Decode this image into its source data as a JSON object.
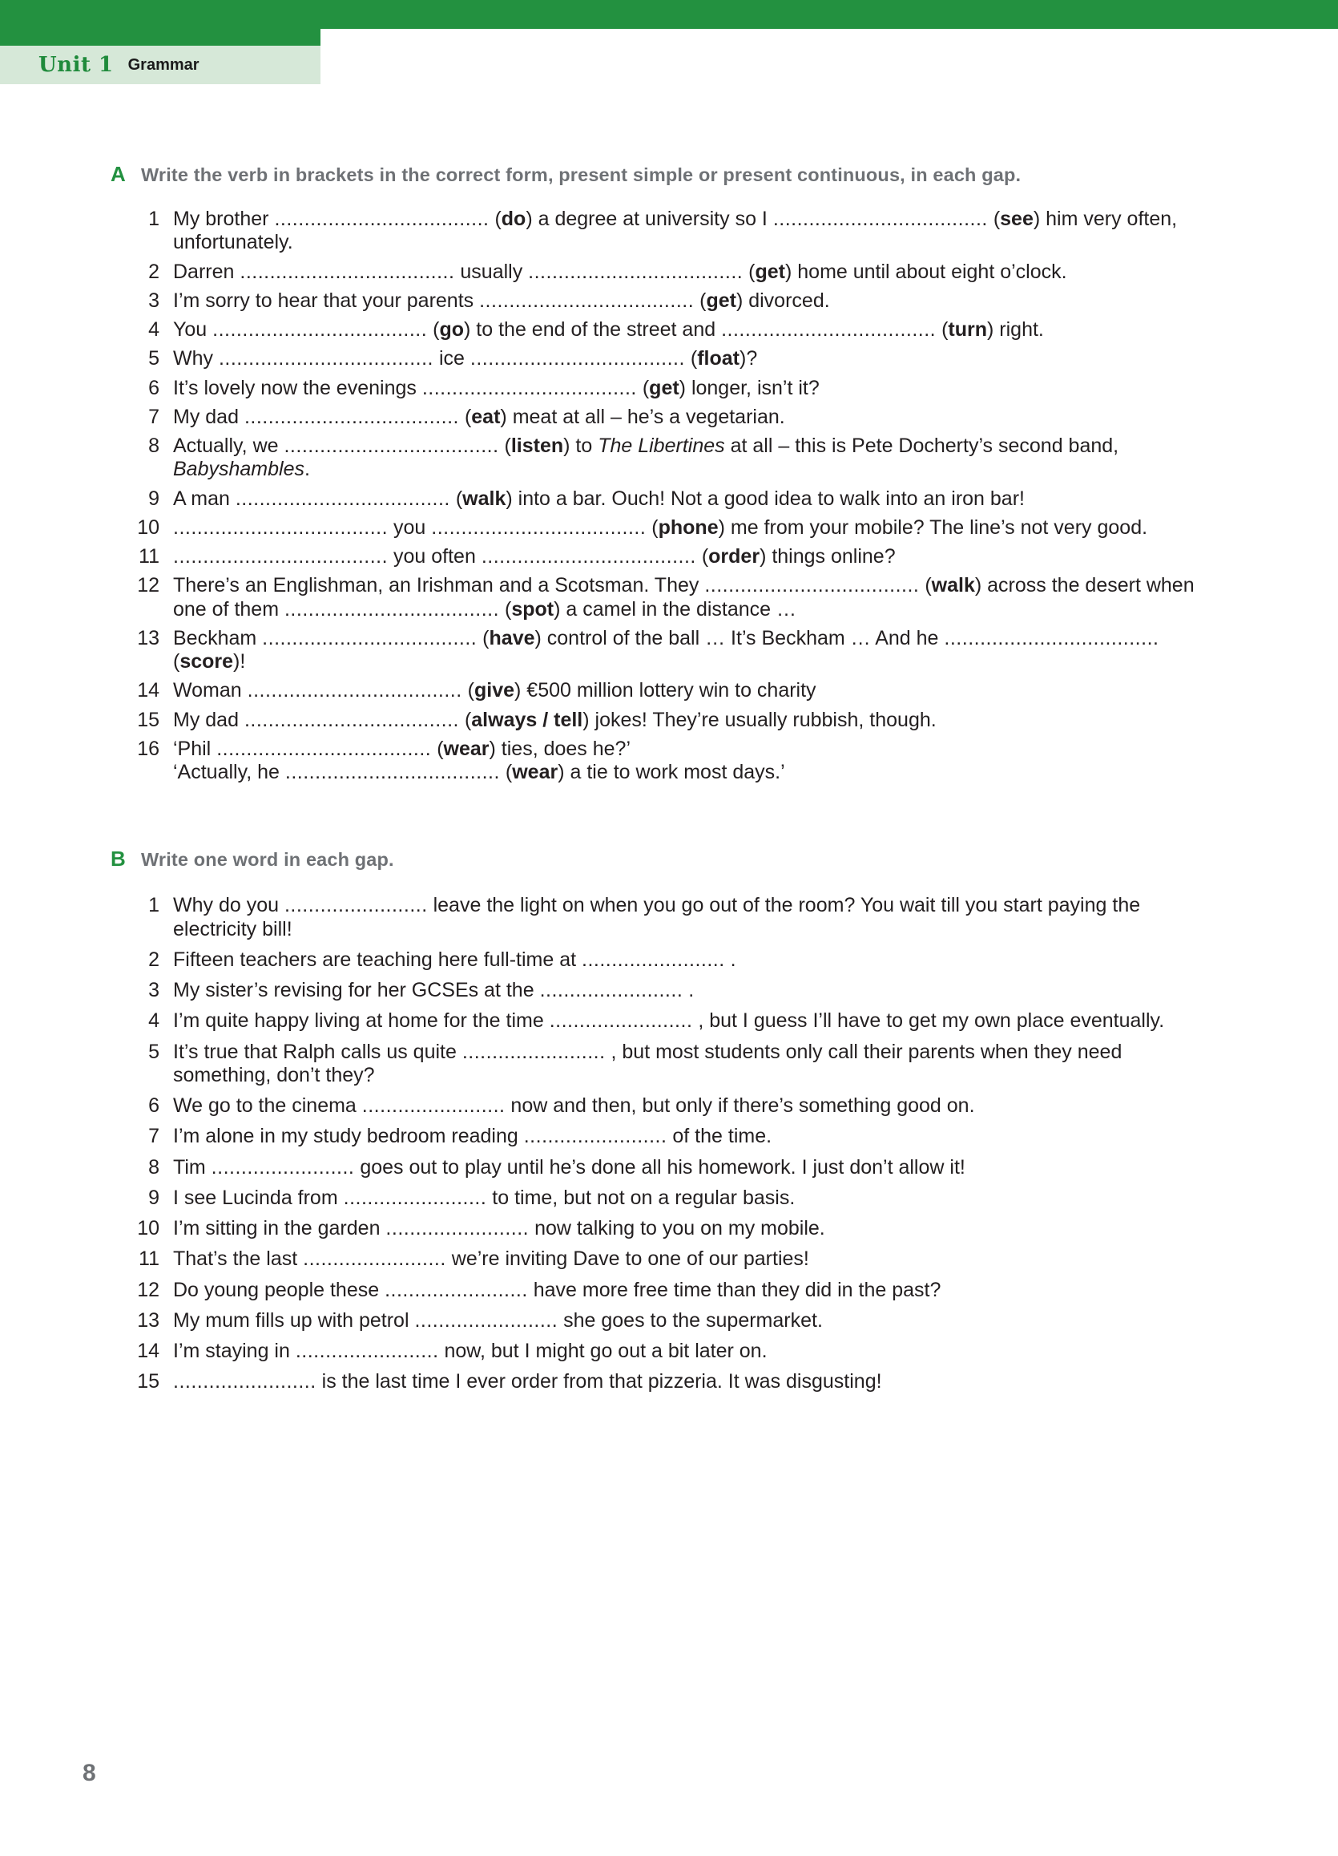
{
  "header": {
    "unit_label": "Unit 1",
    "section_label": "Grammar",
    "band_color": "#239140",
    "tab_color": "#d6e8d8"
  },
  "exercises": [
    {
      "letter": "A",
      "instruction": "Write the verb in brackets in the correct form, present simple or present continuous, in each gap.",
      "gap": "long",
      "items": [
        {
          "num": "1",
          "html": "My brother <span class=\"gap-long\"></span> (<b>do</b>) a degree at university so I <span class=\"gap-long\"></span> (<b>see</b>) him very often, unfortunately."
        },
        {
          "num": "2",
          "html": "Darren <span class=\"gap-long\"></span> usually <span class=\"gap-long\"></span> (<b>get</b>) home until about eight o’clock."
        },
        {
          "num": "3",
          "html": "I’m sorry to hear that your parents <span class=\"gap-long\"></span> (<b>get</b>) divorced."
        },
        {
          "num": "4",
          "html": "You <span class=\"gap-long\"></span> (<b>go</b>) to the end of the street and <span class=\"gap-long\"></span> (<b>turn</b>) right."
        },
        {
          "num": "5",
          "html": "Why <span class=\"gap-long\"></span> ice <span class=\"gap-long\"></span> (<b>float</b>)?"
        },
        {
          "num": "6",
          "html": "It’s lovely now the evenings <span class=\"gap-long\"></span> (<b>get</b>) longer, isn’t it?"
        },
        {
          "num": "7",
          "html": "My dad <span class=\"gap-long\"></span> (<b>eat</b>) meat at all – he’s a vegetarian."
        },
        {
          "num": "8",
          "html": "Actually, we <span class=\"gap-long\"></span> (<b>listen</b>) to <i>The Libertines</i> at all – this is Pete Docherty’s second band, <i>Babyshambles</i>."
        },
        {
          "num": "9",
          "html": "A man <span class=\"gap-long\"></span> (<b>walk</b>) into a bar. Ouch! Not a good idea to walk into an iron bar!"
        },
        {
          "num": "10",
          "html": "<span class=\"gap-long\"></span> you <span class=\"gap-long\"></span> (<b>phone</b>) me from your mobile? The line’s not very good."
        },
        {
          "num": "11",
          "html": "<span class=\"gap-long\"></span> you often <span class=\"gap-long\"></span> (<b>order</b>) things online?"
        },
        {
          "num": "12",
          "html": "There’s an Englishman, an Irishman and a Scotsman. They <span class=\"gap-long\"></span> (<b>walk</b>) across the desert when one of them <span class=\"gap-long\"></span> (<b>spot</b>) a camel in the distance …"
        },
        {
          "num": "13",
          "html": "Beckham <span class=\"gap-long\"></span> (<b>have</b>) control of the ball … It’s Beckham … And he <span class=\"gap-long\"></span> (<b>score</b>)!"
        },
        {
          "num": "14",
          "html": "Woman <span class=\"gap-long\"></span> (<b>give</b>) €500 million lottery win to charity"
        },
        {
          "num": "15",
          "html": "My dad <span class=\"gap-long\"></span> (<b>always / tell</b>) jokes! They’re usually rubbish, though."
        },
        {
          "num": "16",
          "html": "‘Phil <span class=\"gap-long\"></span> (<b>wear</b>) ties, does he?’<br>‘Actually, he <span class=\"gap-long\"></span> (<b>wear</b>) a tie to work most days.’"
        }
      ]
    },
    {
      "letter": "B",
      "instruction": "Write one word in each gap.",
      "gap": "short",
      "items": [
        {
          "num": "1",
          "html": "Why do you <span class=\"gap-short\"></span> leave the light on when you go out of the room? You wait till you start paying the electricity bill!"
        },
        {
          "num": "2",
          "html": "Fifteen teachers are teaching here full-time at <span class=\"gap-short\"></span> ."
        },
        {
          "num": "3",
          "html": "My sister’s revising for her GCSEs at the <span class=\"gap-short\"></span> ."
        },
        {
          "num": "4",
          "html": "I’m quite happy living at home for the time <span class=\"gap-short\"></span> , but I guess I’ll have to get my own place eventually."
        },
        {
          "num": "5",
          "html": "It’s true that Ralph calls us quite <span class=\"gap-short\"></span> , but most students only call their parents when they need something, don’t they?"
        },
        {
          "num": "6",
          "html": "We go to the cinema <span class=\"gap-short\"></span> now and then, but only if there’s something good on."
        },
        {
          "num": "7",
          "html": "I’m alone in my study bedroom reading <span class=\"gap-short\"></span> of the time."
        },
        {
          "num": "8",
          "html": "Tim <span class=\"gap-short\"></span> goes out to play until he’s done all his homework. I just don’t allow it!"
        },
        {
          "num": "9",
          "html": "I see Lucinda from <span class=\"gap-short\"></span> to time, but not on a regular basis."
        },
        {
          "num": "10",
          "html": "I’m sitting in the garden <span class=\"gap-short\"></span> now talking to you on my mobile."
        },
        {
          "num": "11",
          "html": "That’s the last <span class=\"gap-short\"></span> we’re inviting Dave to one of our parties!"
        },
        {
          "num": "12",
          "html": "Do young people these <span class=\"gap-short\"></span> have more free time than they did in the past?"
        },
        {
          "num": "13",
          "html": "My mum fills up with petrol <span class=\"gap-short\"></span> she goes to the supermarket."
        },
        {
          "num": "14",
          "html": "I’m staying in <span class=\"gap-short\"></span> now, but I might go out a bit later on."
        },
        {
          "num": "15",
          "html": "<span class=\"gap-short\"></span> is the last time I ever order from that pizzeria. It was disgusting!"
        }
      ]
    }
  ],
  "footer": {
    "page_number": "8"
  }
}
